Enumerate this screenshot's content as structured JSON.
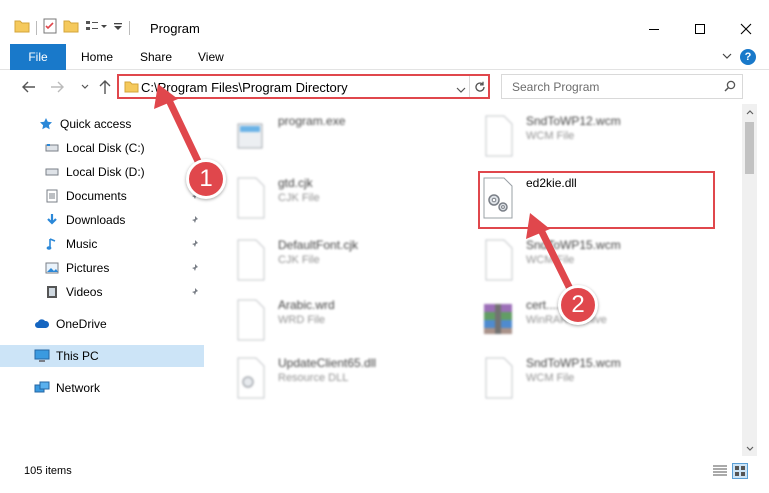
{
  "window": {
    "title": "Program"
  },
  "ribbon": {
    "tabs": [
      "File",
      "Home",
      "Share",
      "View"
    ],
    "help_label": "?"
  },
  "navigation": {
    "address": "C:\\Program Files\\Program Directory",
    "search_placeholder": "Search Program"
  },
  "sidebar": {
    "items": [
      {
        "label": "Quick access",
        "icon": "star-icon",
        "pinned": false,
        "selected": false
      },
      {
        "label": "Local Disk (C:)",
        "icon": "drive-icon",
        "pinned": false,
        "selected": false
      },
      {
        "label": "Local Disk (D:)",
        "icon": "drive-icon",
        "pinned": false,
        "selected": false
      },
      {
        "label": "Documents",
        "icon": "documents-icon",
        "pinned": true,
        "selected": false
      },
      {
        "label": "Downloads",
        "icon": "downloads-icon",
        "pinned": true,
        "selected": false
      },
      {
        "label": "Music",
        "icon": "music-icon",
        "pinned": true,
        "selected": false
      },
      {
        "label": "Pictures",
        "icon": "pictures-icon",
        "pinned": true,
        "selected": false
      },
      {
        "label": "Videos",
        "icon": "videos-icon",
        "pinned": true,
        "selected": false
      },
      {
        "label": "OneDrive",
        "icon": "cloud-icon",
        "pinned": false,
        "selected": false
      },
      {
        "label": "This PC",
        "icon": "computer-icon",
        "pinned": false,
        "selected": true
      },
      {
        "label": "Network",
        "icon": "network-icon",
        "pinned": false,
        "selected": false
      }
    ]
  },
  "files": [
    {
      "name": "program.exe",
      "type": "",
      "icon": "exe-icon"
    },
    {
      "name": "SndToWP12.wcm",
      "type": "WCM File",
      "icon": "file-icon"
    },
    {
      "name": "gtd.cjk",
      "type": "CJK File",
      "icon": "file-icon"
    },
    {
      "name": "ed2kie.dll",
      "type": "",
      "icon": "dll-icon"
    },
    {
      "name": "DefaultFont.cjk",
      "type": "CJK File",
      "icon": "file-icon"
    },
    {
      "name": "SndToWP15.wcm",
      "type": "WCM File",
      "icon": "file-icon"
    },
    {
      "name": "Arabic.wrd",
      "type": "WRD File",
      "icon": "file-icon"
    },
    {
      "name": "cert....s.cab",
      "type": "WinRAR archive",
      "icon": "archive-icon"
    },
    {
      "name": "UpdateClient65.dll",
      "type": "Resource DLL",
      "icon": "dll-icon"
    },
    {
      "name": "SndToWP15.wcm",
      "type": "WCM File",
      "icon": "file-icon"
    }
  ],
  "status": {
    "item_count": "105 items"
  },
  "callouts": [
    "1",
    "2"
  ],
  "colors": {
    "accent": "#1979ca",
    "callout": "#e0474c",
    "selection": "#cce4f7"
  }
}
